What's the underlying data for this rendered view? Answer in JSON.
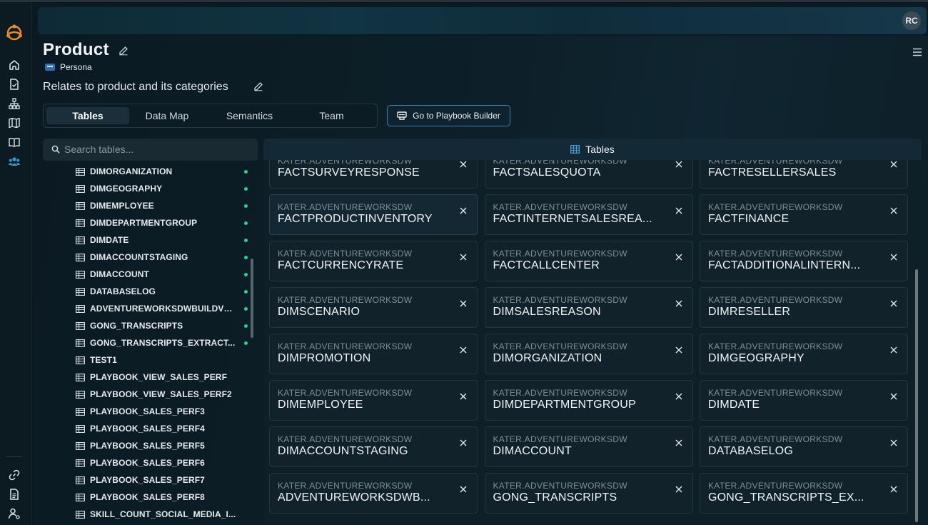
{
  "user": {
    "initials": "RC"
  },
  "page": {
    "title": "Product",
    "type_label": "Persona",
    "description": "Relates to product and its categories"
  },
  "tabs": [
    {
      "label": "Tables",
      "active": true
    },
    {
      "label": "Data Map",
      "active": false
    },
    {
      "label": "Semantics",
      "active": false
    },
    {
      "label": "Team",
      "active": false
    }
  ],
  "playbook_button": "Go to Playbook Builder",
  "search": {
    "placeholder": "Search tables..."
  },
  "tree_items": [
    {
      "label": "DIMORGANIZATION",
      "status": true
    },
    {
      "label": "DIMGEOGRAPHY",
      "status": true
    },
    {
      "label": "DIMEMPLOYEE",
      "status": true
    },
    {
      "label": "DIMDEPARTMENTGROUP",
      "status": true
    },
    {
      "label": "DIMDATE",
      "status": true
    },
    {
      "label": "DIMACCOUNTSTAGING",
      "status": true
    },
    {
      "label": "DIMACCOUNT",
      "status": true
    },
    {
      "label": "DATABASELOG",
      "status": true
    },
    {
      "label": "ADVENTUREWORKSDWBUILDVE...",
      "status": true
    },
    {
      "label": "GONG_TRANSCRIPTS",
      "status": true
    },
    {
      "label": "GONG_TRANSCRIPTS_EXTRACT...",
      "status": true
    },
    {
      "label": "TEST1",
      "status": false
    },
    {
      "label": "PLAYBOOK_VIEW_SALES_PERF",
      "status": false
    },
    {
      "label": "PLAYBOOK_VIEW_SALES_PERF2",
      "status": false
    },
    {
      "label": "PLAYBOOK_SALES_PERF3",
      "status": false
    },
    {
      "label": "PLAYBOOK_SALES_PERF4",
      "status": false
    },
    {
      "label": "PLAYBOOK_SALES_PERF5",
      "status": false
    },
    {
      "label": "PLAYBOOK_SALES_PERF6",
      "status": false
    },
    {
      "label": "PLAYBOOK_SALES_PERF7",
      "status": false
    },
    {
      "label": "PLAYBOOK_SALES_PERF8",
      "status": false
    },
    {
      "label": "SKILL_COUNT_SOCIAL_MEDIA_I...",
      "status": false
    }
  ],
  "tables_panel": {
    "title": "Tables",
    "cards": [
      {
        "schema": "KATER.ADVENTUREWORKSDW",
        "name": "FACTSURVEYRESPONSE"
      },
      {
        "schema": "KATER.ADVENTUREWORKSDW",
        "name": "FACTSALESQUOTA"
      },
      {
        "schema": "KATER.ADVENTUREWORKSDW",
        "name": "FACTRESELLERSALES"
      },
      {
        "schema": "KATER.ADVENTUREWORKSDW",
        "name": "FACTPRODUCTINVENTORY",
        "highlighted": true
      },
      {
        "schema": "KATER.ADVENTUREWORKSDW",
        "name": "FACTINTERNETSALESREA..."
      },
      {
        "schema": "KATER.ADVENTUREWORKSDW",
        "name": "FACTFINANCE"
      },
      {
        "schema": "KATER.ADVENTUREWORKSDW",
        "name": "FACTCURRENCYRATE"
      },
      {
        "schema": "KATER.ADVENTUREWORKSDW",
        "name": "FACTCALLCENTER"
      },
      {
        "schema": "KATER.ADVENTUREWORKSDW",
        "name": "FACTADDITIONALINTERN..."
      },
      {
        "schema": "KATER.ADVENTUREWORKSDW",
        "name": "DIMSCENARIO"
      },
      {
        "schema": "KATER.ADVENTUREWORKSDW",
        "name": "DIMSALESREASON"
      },
      {
        "schema": "KATER.ADVENTUREWORKSDW",
        "name": "DIMRESELLER"
      },
      {
        "schema": "KATER.ADVENTUREWORKSDW",
        "name": "DIMPROMOTION"
      },
      {
        "schema": "KATER.ADVENTUREWORKSDW",
        "name": "DIMORGANIZATION"
      },
      {
        "schema": "KATER.ADVENTUREWORKSDW",
        "name": "DIMGEOGRAPHY"
      },
      {
        "schema": "KATER.ADVENTUREWORKSDW",
        "name": "DIMEMPLOYEE"
      },
      {
        "schema": "KATER.ADVENTUREWORKSDW",
        "name": "DIMDEPARTMENTGROUP"
      },
      {
        "schema": "KATER.ADVENTUREWORKSDW",
        "name": "DIMDATE"
      },
      {
        "schema": "KATER.ADVENTUREWORKSDW",
        "name": "DIMACCOUNTSTAGING"
      },
      {
        "schema": "KATER.ADVENTUREWORKSDW",
        "name": "DIMACCOUNT"
      },
      {
        "schema": "KATER.ADVENTUREWORKSDW",
        "name": "DATABASELOG"
      },
      {
        "schema": "KATER.ADVENTUREWORKSDW",
        "name": "ADVENTUREWORKSDWB..."
      },
      {
        "schema": "KATER.ADVENTUREWORKSDW",
        "name": "GONG_TRANSCRIPTS"
      },
      {
        "schema": "KATER.ADVENTUREWORKSDW",
        "name": "GONG_TRANSCRIPTS_EX..."
      }
    ]
  },
  "nav_icons": [
    "home-icon",
    "document-icon",
    "hierarchy-icon",
    "map-icon",
    "book-icon",
    "team-icon",
    "link-icon",
    "file-icon",
    "user-settings-icon"
  ],
  "colors": {
    "accent": "#3f7fb8",
    "status_dot": "#2fd08a",
    "logo": "#f08a24",
    "active_nav": "#2a9fd6"
  }
}
